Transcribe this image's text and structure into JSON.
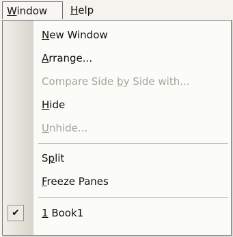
{
  "menubar": {
    "window_pre": "",
    "window_key": "W",
    "window_post": "indow",
    "help_pre": "",
    "help_key": "H",
    "help_post": "elp"
  },
  "menu": {
    "items": [
      {
        "pre": "",
        "key": "N",
        "post": "ew Window",
        "enabled": true
      },
      {
        "pre": "",
        "key": "A",
        "post": "rrange...",
        "enabled": true
      },
      {
        "pre": "Compare Side ",
        "key": "b",
        "post": "y Side with...",
        "enabled": false
      },
      {
        "pre": "",
        "key": "H",
        "post": "ide",
        "enabled": true
      },
      {
        "pre": "",
        "key": "U",
        "post": "nhide...",
        "enabled": false
      },
      {
        "pre": "S",
        "key": "p",
        "post": "lit",
        "enabled": true
      },
      {
        "pre": "",
        "key": "F",
        "post": "reeze Panes",
        "enabled": true
      },
      {
        "pre": "",
        "key": "1",
        "post": " Book1",
        "enabled": true,
        "checked": true
      }
    ],
    "check_glyph": "✔"
  }
}
